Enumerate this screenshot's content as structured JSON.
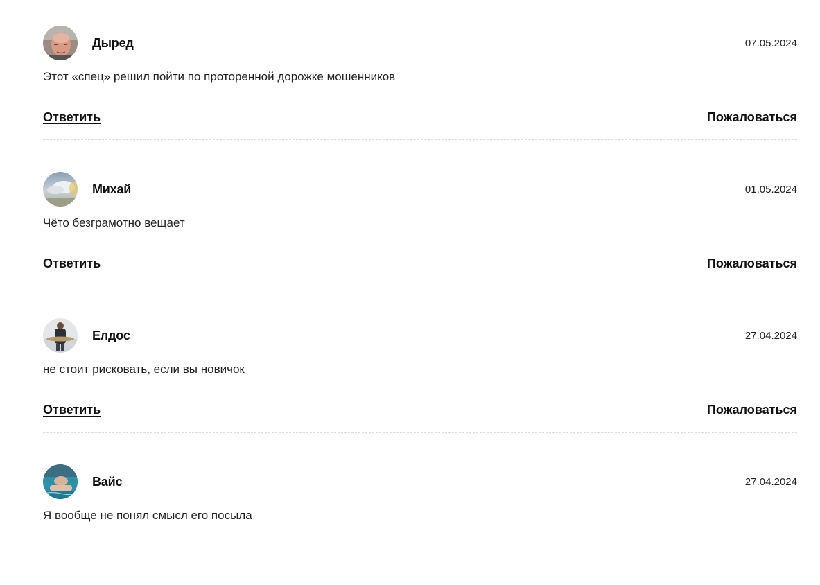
{
  "comments": [
    {
      "author": "Дыред",
      "date": "07.05.2024",
      "text": "Этот «спец» решил пойти по проторенной дорожке мошенников",
      "reply_label": "Ответить",
      "report_label": "Пожаловаться",
      "avatar": "avatar-photo-man-face"
    },
    {
      "author": "Михай",
      "date": "01.05.2024",
      "text": "Чёто безграмотно вещает",
      "reply_label": "Ответить",
      "report_label": "Пожаловаться",
      "avatar": "avatar-photo-sky"
    },
    {
      "author": "Елдос",
      "date": "27.04.2024",
      "text": "не стоит рисковать, если вы новичок",
      "reply_label": "Ответить",
      "report_label": "Пожаловаться",
      "avatar": "avatar-photo-fisherman"
    },
    {
      "author": "Вайс",
      "date": "27.04.2024",
      "text": "Я вообще не понял смысл его посыла",
      "reply_label": "Ответить",
      "report_label": "Пожаловаться",
      "avatar": "avatar-photo-pool"
    }
  ]
}
